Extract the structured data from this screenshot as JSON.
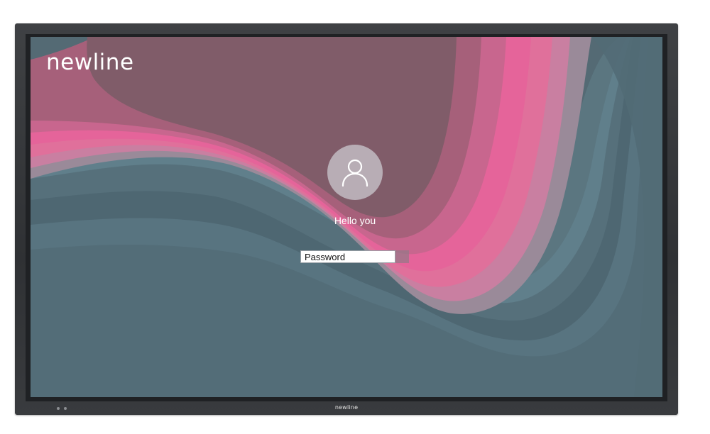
{
  "screen": {
    "brand_logo_text": "newline",
    "login": {
      "avatar_icon": "user-icon",
      "user_name": "Hello you",
      "password_placeholder": "Password",
      "password_value": "",
      "submit_icon": "arrow-right-icon"
    }
  },
  "bezel": {
    "logo_text": "newline",
    "indicator_icons": [
      "power-indicator-icon",
      "sensor-indicator-icon"
    ]
  },
  "colors": {
    "bezel": "#333538",
    "wallpaper_slate": "#556c76",
    "wallpaper_mauve": "#805c69",
    "wallpaper_pink": "#e0648f"
  }
}
